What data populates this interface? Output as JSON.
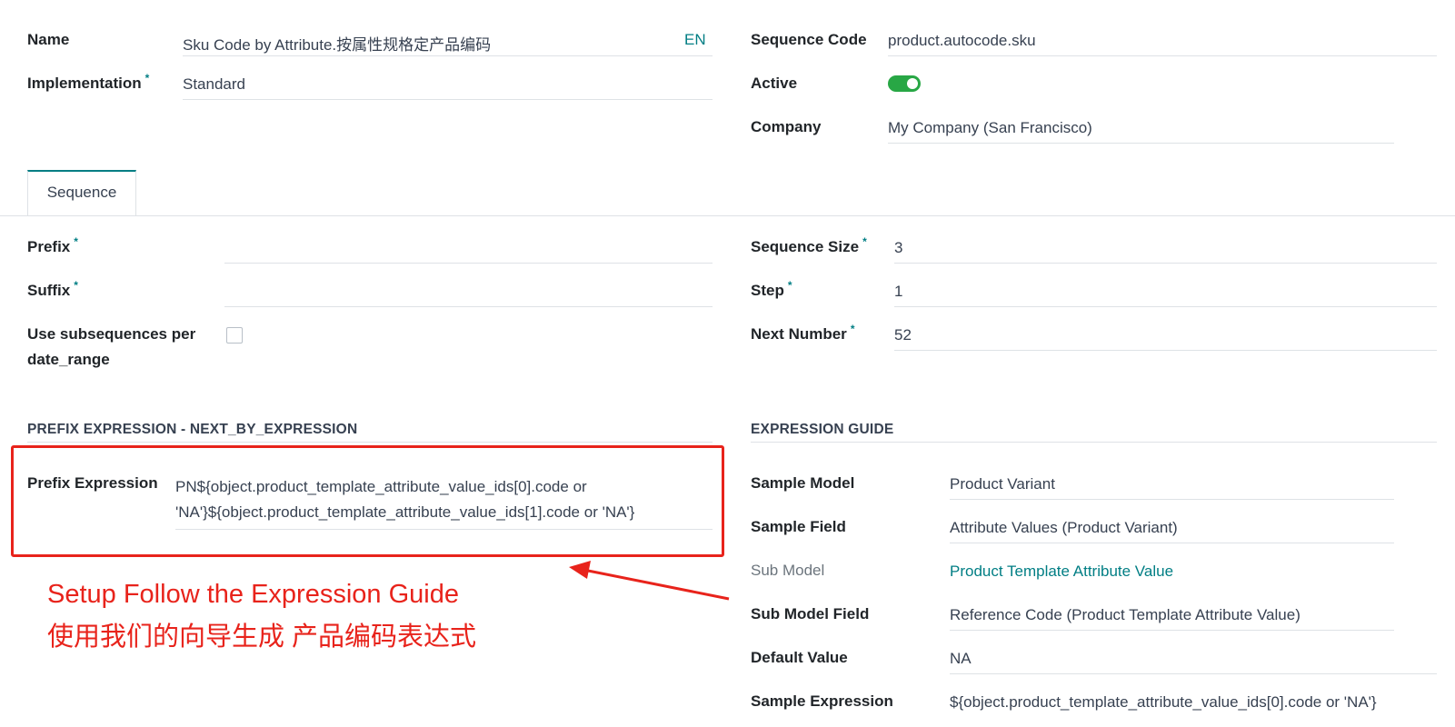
{
  "header_left": {
    "name_label": "Name",
    "name_value": "Sku Code by Attribute.按属性规格定产品编码",
    "lang_badge": "EN",
    "implementation_label": "Implementation",
    "implementation_value": "Standard",
    "required_mark": "*"
  },
  "header_right": {
    "sequence_code_label": "Sequence Code",
    "sequence_code_value": "product.autocode.sku",
    "active_label": "Active",
    "active_on": true,
    "company_label": "Company",
    "company_value": "My Company (San Francisco)"
  },
  "tabs": [
    {
      "label": "Sequence",
      "active": true
    }
  ],
  "sequence_left": {
    "prefix_label": "Prefix",
    "prefix_value": "",
    "suffix_label": "Suffix",
    "suffix_value": "",
    "subseq_label_line1": "Use subsequences per",
    "subseq_label_line2": "date_range",
    "subseq_checked": false
  },
  "sequence_right": {
    "size_label": "Sequence Size",
    "size_value": "3",
    "step_label": "Step",
    "step_value": "1",
    "next_label": "Next Number",
    "next_value": "52"
  },
  "prefix_expression": {
    "section_title": "PREFIX EXPRESSION - NEXT_BY_EXPRESSION",
    "label": "Prefix Expression",
    "value_line1": "PN${object.product_template_attribute_value_ids[0].code or",
    "value_line2": "'NA'}${object.product_template_attribute_value_ids[1].code or 'NA'}"
  },
  "expression_guide": {
    "section_title": "EXPRESSION GUIDE",
    "sample_model_label": "Sample Model",
    "sample_model_value": "Product Variant",
    "sample_field_label": "Sample Field",
    "sample_field_value": "Attribute Values (Product Variant)",
    "sub_model_label": "Sub Model",
    "sub_model_value": "Product Template Attribute Value",
    "sub_model_field_label": "Sub Model Field",
    "sub_model_field_value": "Reference Code (Product Template Attribute Value)",
    "default_value_label": "Default Value",
    "default_value_value": "NA",
    "sample_expression_label": "Sample Expression",
    "sample_expression_value": "${object.product_template_attribute_value_ids[0].code or 'NA'}"
  },
  "annotation": {
    "line1": "Setup Follow the Expression Guide",
    "line2": "使用我们的向导生成 产品编码表达式",
    "color": "#e8231b"
  },
  "colors": {
    "accent": "#017e84",
    "toggle_on": "#28a745"
  }
}
